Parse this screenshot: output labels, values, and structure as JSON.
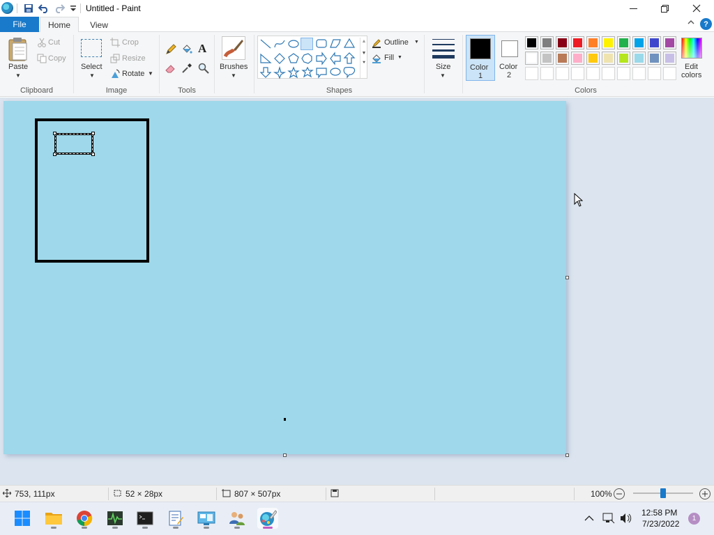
{
  "window": {
    "title": "Untitled - Paint",
    "minimize": "—",
    "maximize": "❐",
    "close": "✕"
  },
  "tabs": {
    "file": "File",
    "home": "Home",
    "view": "View",
    "help": "?"
  },
  "ribbon": {
    "clipboard": {
      "paste": "Paste",
      "cut": "Cut",
      "copy": "Copy",
      "label": "Clipboard"
    },
    "image": {
      "select": "Select",
      "crop": "Crop",
      "resize": "Resize",
      "rotate": "Rotate",
      "label": "Image"
    },
    "tools": {
      "label": "Tools",
      "text_glyph": "A"
    },
    "brushes": {
      "label": "Brushes"
    },
    "shapes": {
      "outline": "Outline",
      "fill": "Fill",
      "label": "Shapes"
    },
    "size": {
      "label": "Size"
    },
    "colors": {
      "color1": "Color",
      "color1_num": "1",
      "color2": "Color",
      "color2_num": "2",
      "edit": "Edit",
      "edit2": "colors",
      "label": "Colors",
      "color1_value": "#000000",
      "color2_value": "#ffffff",
      "palette_row1": [
        "#000000",
        "#7f7f7f",
        "#880015",
        "#ed1c24",
        "#ff7f27",
        "#fff200",
        "#22b14c",
        "#00a2e8",
        "#3f48cc",
        "#a349a4"
      ],
      "palette_row2": [
        "#ffffff",
        "#c3c3c3",
        "#b97a57",
        "#ffaec9",
        "#ffc90e",
        "#efe4b0",
        "#b5e61d",
        "#99d9ea",
        "#7092be",
        "#c8bfe7"
      ],
      "palette_row3_empty": 10
    }
  },
  "canvas": {
    "background": "#9ed8ea"
  },
  "status": {
    "cursor_pos": "753, 111px",
    "selection_size": "52 × 28px",
    "canvas_size": "807 × 507px",
    "zoom": "100%",
    "zoom_level": 0.5
  },
  "taskbar": {
    "time": "12:58 PM",
    "date": "7/23/2022",
    "notifications": "1"
  }
}
